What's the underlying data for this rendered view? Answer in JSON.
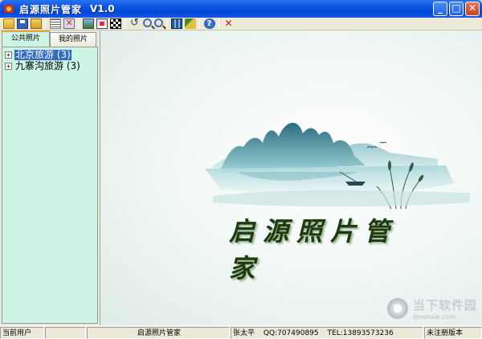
{
  "window": {
    "title": "启源照片管家",
    "version": "V1.0",
    "minimize_label": "_",
    "maximize_label": "□",
    "close_label": "✕"
  },
  "toolbar": {
    "buttons": [
      "open-icon",
      "save-icon",
      "folder-icon",
      "list-icon",
      "delete-icon",
      "image-icon",
      "edit-image-icon",
      "checker-icon",
      "rotate-icon",
      "zoom-in-icon",
      "zoom-out-icon",
      "slideshow-icon",
      "tools-icon",
      "help-icon",
      "exit-icon"
    ],
    "rotate_glyph": "↺",
    "help_glyph": "?",
    "exit_glyph": "✕"
  },
  "left_panel": {
    "tabs": [
      {
        "label": "公共照片",
        "active": true
      },
      {
        "label": "我的照片",
        "active": false
      }
    ],
    "tree": [
      {
        "expander": "+",
        "label": "北京旅游 (3)",
        "selected": true
      },
      {
        "expander": "+",
        "label": "九寨沟旅游 (3)",
        "selected": false
      }
    ]
  },
  "canvas": {
    "brand_text": "启源照片管家",
    "watermark_cn": "当下软件园",
    "watermark_url": "downxia.com"
  },
  "statusbar": {
    "current_user_label": "当前用户",
    "current_user_value": "",
    "app_name": "启源照片管家",
    "author": "张太平",
    "qq": "QQ:707490895",
    "tel": "TEL:13893573236",
    "version_status": "未注册版本"
  },
  "colors": {
    "titlebar": "#0a55e0",
    "tree_bg": "#ccf5e6",
    "selection": "#316ac5",
    "brand_text": "#1e3a0f"
  }
}
